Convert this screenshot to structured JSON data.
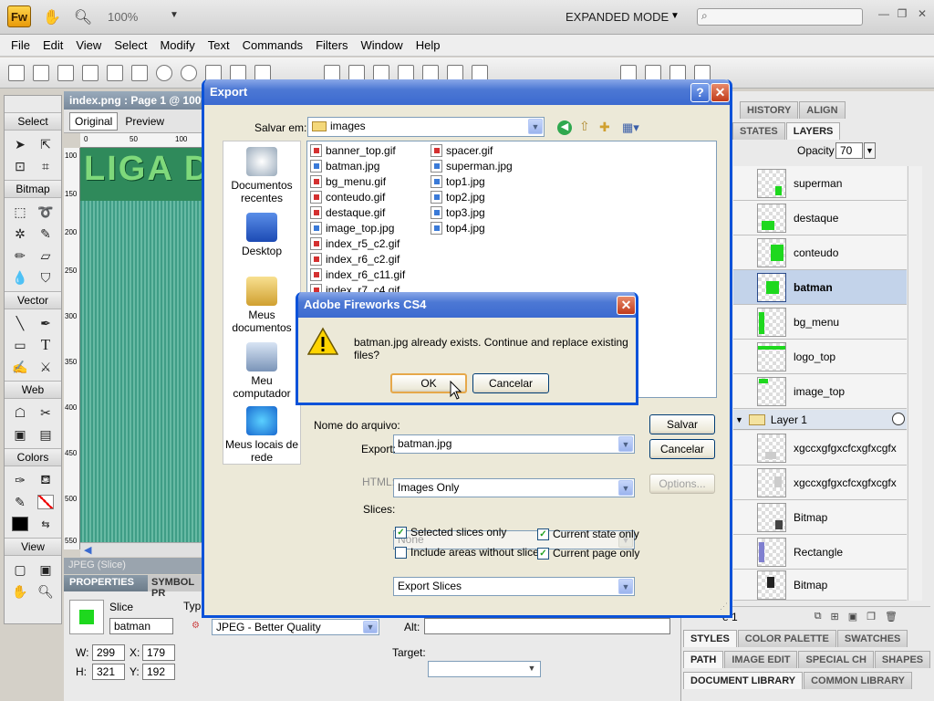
{
  "app": {
    "logo": "Fw",
    "zoom": "100%",
    "mode": "EXPANDED MODE",
    "icons": [
      "hand-icon",
      "zoom-icon",
      "search-icon"
    ]
  },
  "menu": [
    "File",
    "Edit",
    "View",
    "Select",
    "Modify",
    "Text",
    "Commands",
    "Filters",
    "Window",
    "Help"
  ],
  "tools": {
    "select": "Select",
    "bitmap": "Bitmap",
    "vector": "Vector",
    "web": "Web",
    "colors": "Colors",
    "view": "View"
  },
  "document": {
    "tab": "index.png : Page 1 @ 100%",
    "views": [
      "Original",
      "Preview"
    ],
    "ruler_top": [
      "0",
      "50",
      "100"
    ],
    "ruler_left": [
      "100",
      "150",
      "200",
      "250",
      "300",
      "350",
      "400",
      "450",
      "500",
      "550"
    ],
    "canvas_text": "LIGA D",
    "status": "JPEG (Slice)"
  },
  "properties": {
    "tab": "PROPERTIES",
    "tab2": "SYMBOL PR",
    "slice_label": "Slice",
    "slice_name": "batman",
    "type_label": "Typ",
    "format": "JPEG - Better Quality",
    "alt_label": "Alt:",
    "target_label": "Target:",
    "w": "299",
    "x": "179",
    "h": "321",
    "y": "192"
  },
  "panels": {
    "top_tabs": [
      "HISTORY",
      "ALIGN"
    ],
    "layer_tabs": [
      "STATES",
      "LAYERS"
    ],
    "opacity_label": "Opacity",
    "opacity": "70",
    "layers": [
      "superman",
      "destaque",
      "conteudo",
      "batman",
      "bg_menu",
      "logo_top",
      "image_top"
    ],
    "layer1": "Layer 1",
    "objects": [
      "xgccxgfgxcfcxgfxcgfx",
      "xgccxgfgxcfcxgfxcgfx",
      "Bitmap",
      "Rectangle",
      "Bitmap"
    ],
    "footer_page": "e 1",
    "bottom_tabs_1": [
      "STYLES",
      "COLOR PALETTE",
      "SWATCHES"
    ],
    "bottom_tabs_2": [
      "PATH",
      "IMAGE EDIT",
      "SPECIAL CH",
      "SHAPES"
    ],
    "bottom_tabs_3": [
      "DOCUMENT LIBRARY",
      "COMMON LIBRARY"
    ]
  },
  "export_dialog": {
    "title": "Export",
    "save_in_label": "Salvar em:",
    "folder": "images",
    "places": [
      "Documentos recentes",
      "Desktop",
      "Meus documentos",
      "Meu computador",
      "Meus locais de rede"
    ],
    "files_col1": [
      "banner_top.gif",
      "batman.jpg",
      "bg_menu.gif",
      "conteudo.gif",
      "destaque.gif",
      "image_top.jpg",
      "index_r5_c2.gif",
      "index_r6_c2.gif",
      "index_r6_c11.gif",
      "index_r7_c4.gif"
    ],
    "files_col2": [
      "spacer.gif",
      "superman.jpg",
      "top1.jpg",
      "top2.jpg",
      "top3.jpg",
      "top4.jpg"
    ],
    "filename_label": "Nome do arquivo:",
    "filename": "batman.jpg",
    "export_label": "Export:",
    "export_value": "Images Only",
    "html_label": "HTML:",
    "html_value": "None",
    "slices_label": "Slices:",
    "slices_value": "Export Slices",
    "options_button": "Options...",
    "save_button": "Salvar",
    "cancel_button": "Cancelar",
    "checkboxes": [
      {
        "label": "Selected slices only",
        "checked": true
      },
      {
        "label": "Include areas without slices",
        "checked": false
      },
      {
        "label": "Current state only",
        "checked": true
      },
      {
        "label": "Current page only",
        "checked": true
      }
    ]
  },
  "confirm_dialog": {
    "title": "Adobe Fireworks CS4",
    "message": "batman.jpg already exists. Continue and replace existing files?",
    "ok": "OK",
    "cancel": "Cancelar"
  },
  "colors": {
    "xp_blue": "#0a52d9",
    "selected_layer": "#c3d3ea",
    "canvas_green": "#3f9d86"
  }
}
